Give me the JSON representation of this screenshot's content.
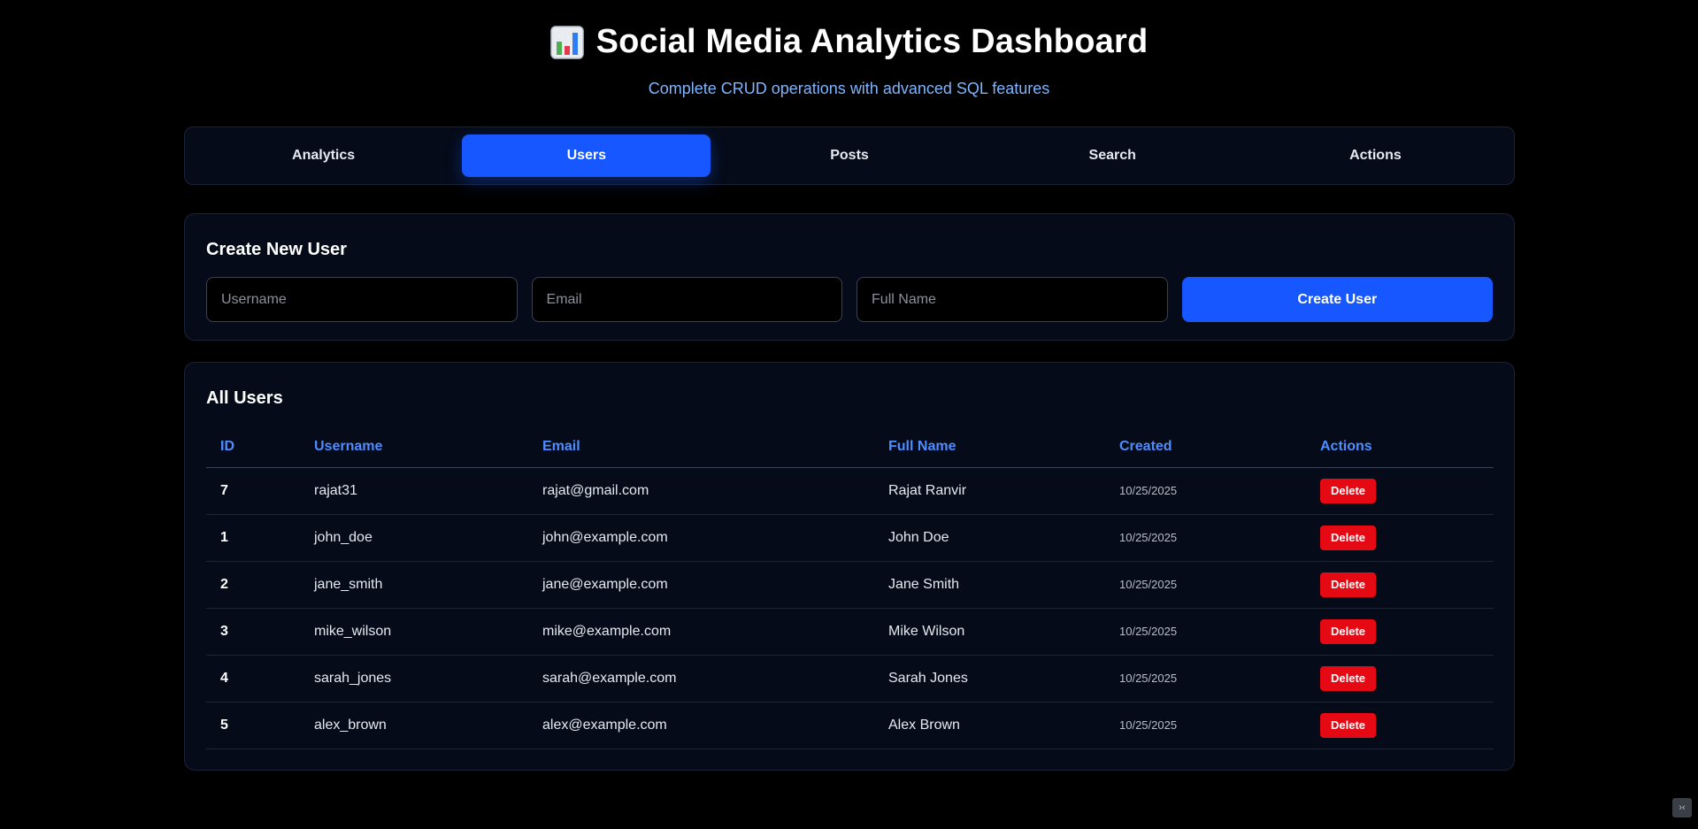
{
  "header": {
    "title": "Social Media Analytics Dashboard",
    "subtitle": "Complete CRUD operations with advanced SQL features",
    "icon": "bar-chart-icon"
  },
  "tabs": [
    {
      "label": "Analytics",
      "active": false
    },
    {
      "label": "Users",
      "active": true
    },
    {
      "label": "Posts",
      "active": false
    },
    {
      "label": "Search",
      "active": false
    },
    {
      "label": "Actions",
      "active": false
    }
  ],
  "create_user": {
    "title": "Create New User",
    "username_placeholder": "Username",
    "email_placeholder": "Email",
    "fullname_placeholder": "Full Name",
    "button_label": "Create User"
  },
  "users_table": {
    "title": "All Users",
    "columns": [
      "ID",
      "Username",
      "Email",
      "Full Name",
      "Created",
      "Actions"
    ],
    "rows": [
      {
        "id": "7",
        "username": "rajat31",
        "email": "rajat@gmail.com",
        "full_name": "Rajat Ranvir",
        "created": "10/25/2025",
        "action": "Delete"
      },
      {
        "id": "1",
        "username": "john_doe",
        "email": "john@example.com",
        "full_name": "John Doe",
        "created": "10/25/2025",
        "action": "Delete"
      },
      {
        "id": "2",
        "username": "jane_smith",
        "email": "jane@example.com",
        "full_name": "Jane Smith",
        "created": "10/25/2025",
        "action": "Delete"
      },
      {
        "id": "3",
        "username": "mike_wilson",
        "email": "mike@example.com",
        "full_name": "Mike Wilson",
        "created": "10/25/2025",
        "action": "Delete"
      },
      {
        "id": "4",
        "username": "sarah_jones",
        "email": "sarah@example.com",
        "full_name": "Sarah Jones",
        "created": "10/25/2025",
        "action": "Delete"
      },
      {
        "id": "5",
        "username": "alex_brown",
        "email": "alex@example.com",
        "full_name": "Alex Brown",
        "created": "10/25/2025",
        "action": "Delete"
      }
    ]
  },
  "colors": {
    "accent": "#1757ff",
    "header_text": "#4f8dff",
    "danger": "#e50914",
    "subtitle": "#7fb4ff"
  },
  "corner_widget": {
    "icon": "collapse-icon",
    "glyph": "›‹"
  }
}
